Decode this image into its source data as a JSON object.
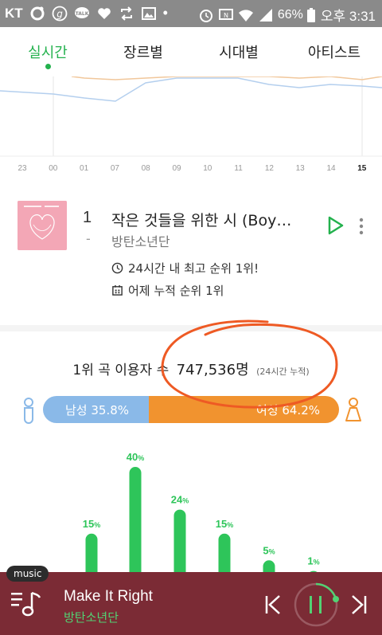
{
  "status_bar": {
    "carrier": "KT",
    "battery_pct": "66%",
    "time": "오후 3:31"
  },
  "tabs": [
    {
      "label": "실시간",
      "active": true
    },
    {
      "label": "장르별",
      "active": false
    },
    {
      "label": "시대별",
      "active": false
    },
    {
      "label": "아티스트",
      "active": false
    }
  ],
  "line_chart": {
    "x_labels": [
      "23",
      "00",
      "01",
      "07",
      "08",
      "09",
      "10",
      "11",
      "12",
      "13",
      "14",
      "15"
    ],
    "highlight_label": "15"
  },
  "song": {
    "rank": "1",
    "rank_change": "-",
    "title": "작은 것들을 위한 시 (Boy…",
    "artist": "방탄소년단",
    "info_best": "24시간 내 최고 순위 1위!",
    "info_cumulative": "어제 누적 순위 1위"
  },
  "stats": {
    "title": "1위 곡 이용자 수",
    "count": "747,536명",
    "note": "(24시간 누적)",
    "male_label": "남성 35.8%",
    "female_label": "여성 64.2%",
    "male_share": 0.358
  },
  "chart_data": {
    "type": "bar",
    "categories": [
      "",
      "",
      "",
      "",
      "",
      ""
    ],
    "values": [
      15,
      40,
      24,
      15,
      5,
      1
    ],
    "value_labels": [
      "15",
      "40",
      "24",
      "15",
      "5",
      "1"
    ],
    "unit": "%",
    "ylim": [
      0,
      40
    ],
    "colors": {
      "bar": "#2ec55a"
    }
  },
  "player": {
    "badge": "music",
    "title": "Make It Right",
    "artist": "방탄소년단"
  }
}
